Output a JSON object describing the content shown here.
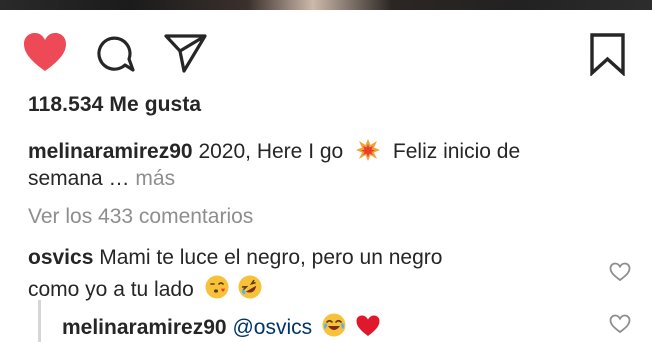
{
  "post": {
    "likes_text": "118.534 Me gusta",
    "caption": {
      "username": "melinaramirez90",
      "text": "2020, Here I go",
      "emoji": "collision-emoji",
      "text_after": "Feliz inicio de",
      "line2": "semana …",
      "more": "más"
    },
    "view_comments": "Ver los 433 comentarios"
  },
  "comments": [
    {
      "username": "osvics",
      "line1": "Mami te luce el negro, pero un negro",
      "line2": "como yo a tu lado",
      "emojis": [
        "kissing-heart-emoji",
        "rofl-emoji"
      ]
    }
  ],
  "reply": {
    "username": "melinaramirez90",
    "mention": "@osvics",
    "emojis": [
      "joy-emoji",
      "red-heart-emoji"
    ]
  },
  "colors": {
    "like_red": "#ed4956",
    "text": "#262626",
    "muted": "#8e8e8e",
    "mention": "#003569"
  }
}
